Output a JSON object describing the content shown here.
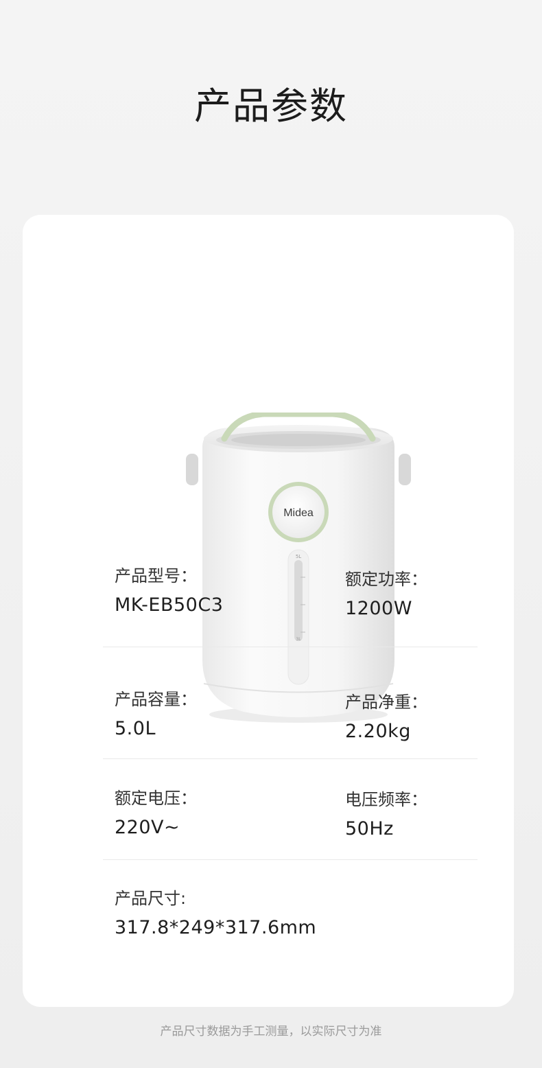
{
  "page": {
    "title": "产品参数",
    "footnote": "产品尺寸数据为手工测量，以实际尺寸为准"
  },
  "product_image": {
    "brand": "Midea",
    "gauge_top": "5L",
    "gauge_bottom": "3L",
    "accent_color": "#c9d9b8",
    "body_color": "#f7f7f7"
  },
  "specs": [
    {
      "label": "产品型号：",
      "value": "MK-EB50C3"
    },
    {
      "label": "额定功率：",
      "value": "1200W"
    },
    {
      "label": "产品容量：",
      "value": "5.0L"
    },
    {
      "label": "产品净重：",
      "value": "2.20kg"
    },
    {
      "label": "额定电压：",
      "value": "220V~"
    },
    {
      "label": "电压频率：",
      "value": "50Hz"
    },
    {
      "label": "产品尺寸:",
      "value": "317.8*249*317.6mm"
    }
  ]
}
